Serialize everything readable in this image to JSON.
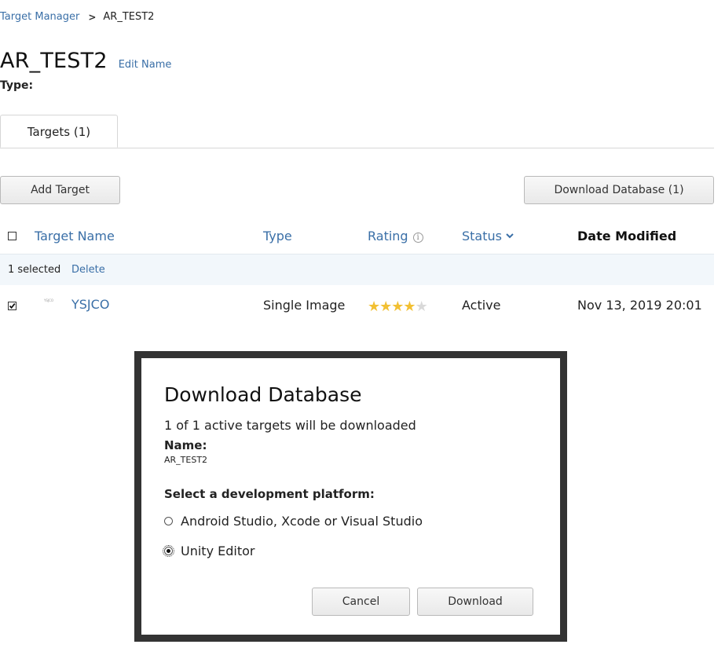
{
  "breadcrumb": {
    "root": "Target Manager",
    "separator": ">",
    "current": "AR_TEST2"
  },
  "header": {
    "title": "AR_TEST2",
    "edit_name": "Edit Name",
    "type_label": "Type:"
  },
  "tabs": [
    {
      "label": "Targets (1)",
      "active": true
    }
  ],
  "toolbar": {
    "add_target": "Add Target",
    "download_database": "Download Database (1)"
  },
  "table": {
    "columns": {
      "name": "Target Name",
      "type": "Type",
      "rating": "Rating",
      "status": "Status",
      "date": "Date Modified"
    },
    "selection": {
      "count": "1 selected",
      "delete": "Delete"
    },
    "rows": [
      {
        "checked": true,
        "thumbnail_text": "YSJCO",
        "name": "YSJCO",
        "type": "Single Image",
        "rating": 4,
        "rating_max": 5,
        "status": "Active",
        "date": "Nov 13, 2019 20:01"
      }
    ]
  },
  "modal": {
    "title": "Download Database",
    "subtitle": "1 of 1 active targets will be downloaded",
    "name_label": "Name:",
    "name_value": "AR_TEST2",
    "platform_label": "Select a development platform:",
    "options": [
      {
        "label": "Android Studio, Xcode or Visual Studio",
        "selected": false
      },
      {
        "label": "Unity Editor",
        "selected": true
      }
    ],
    "cancel": "Cancel",
    "download": "Download"
  },
  "colors": {
    "link": "#3a6fa7",
    "star": "#f2c033",
    "star_empty": "#d9d9d9",
    "selection_bg": "#f2f7fb",
    "modal_border": "#333333"
  }
}
